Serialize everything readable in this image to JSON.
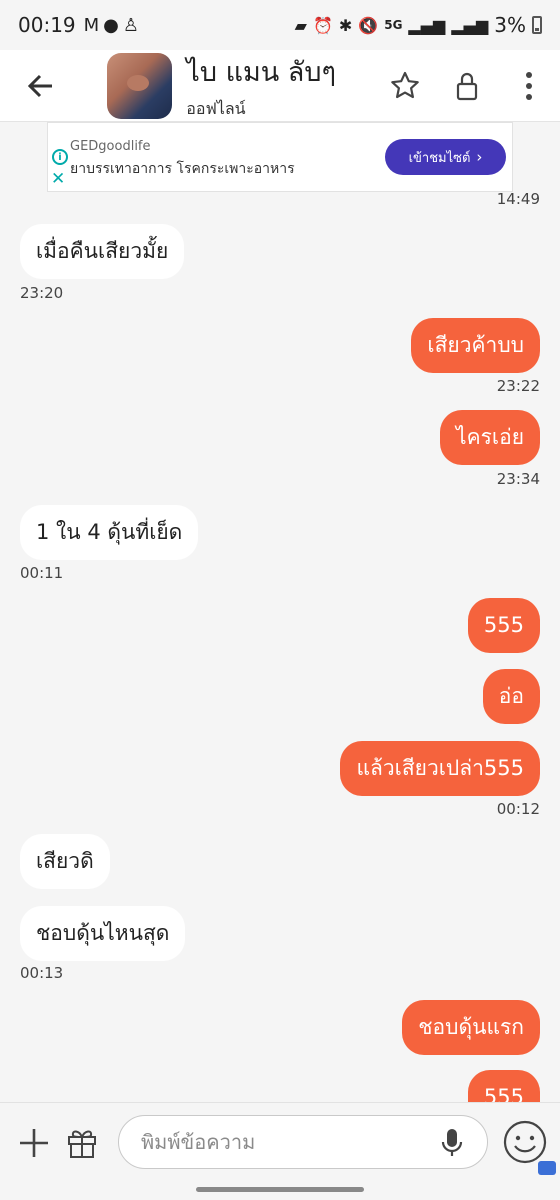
{
  "status_bar": {
    "time": "00:19",
    "network": "5G",
    "battery": "3%"
  },
  "header": {
    "contact_name": "ไบ แมน ลับๆ",
    "status": "ออฟไลน์"
  },
  "ad": {
    "brand": "GEDgoodlife",
    "text": "ยาบรรเทาอาการ โรคกระเพาะอาหาร",
    "cta": "เข้าชมไซต์",
    "cta_color": "#4437b8"
  },
  "messages": [
    {
      "text": "เมื่อคืนเสียวมั้ย",
      "dir": "in"
    },
    {
      "text": "เสียวค้าบบ",
      "dir": "out"
    },
    {
      "text": "ไครเอ่ย",
      "dir": "out"
    },
    {
      "text": "1 ใน 4 ดุ้นที่เย็ด",
      "dir": "in"
    },
    {
      "text": "555",
      "dir": "out"
    },
    {
      "text": "อ่อ",
      "dir": "out"
    },
    {
      "text": "แล้วเสียวเปล่า555",
      "dir": "out"
    },
    {
      "text": "เสียวดิ",
      "dir": "in"
    },
    {
      "text": "ชอบดุ้นไหนสุด",
      "dir": "in"
    },
    {
      "text": "ชอบดุ้นแรก",
      "dir": "out"
    },
    {
      "text": "555",
      "dir": "out"
    }
  ],
  "timestamps": [
    "14:49",
    "23:20",
    "23:22",
    "23:34",
    "00:11",
    "00:12",
    "00:13"
  ],
  "input": {
    "placeholder": "พิมพ์ข้อความ"
  },
  "colors": {
    "outgoing_bubble": "#f5633d",
    "incoming_bubble": "#ffffff",
    "background": "#f5f5f5"
  }
}
